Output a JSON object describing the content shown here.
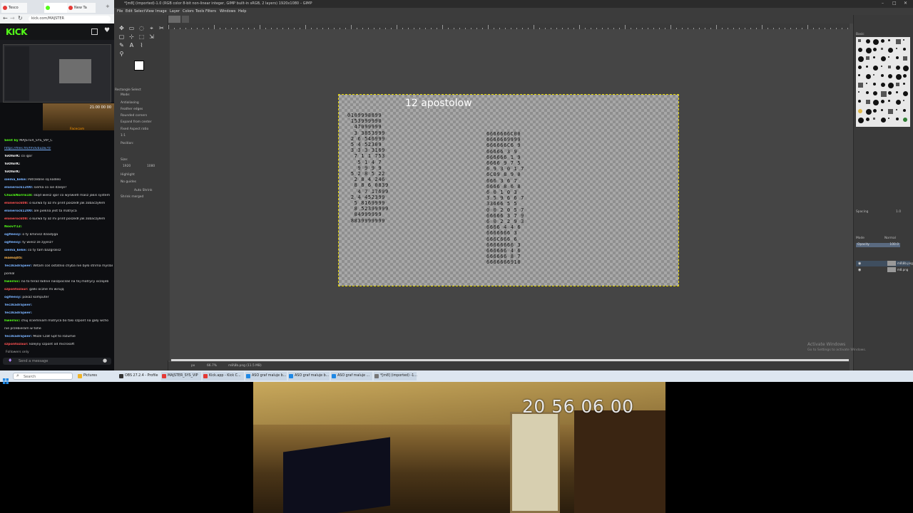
{
  "browser": {
    "tabs": [
      {
        "label": "Tesco",
        "color": "#e53935"
      },
      {
        "label": "",
        "color": "#53fc18"
      },
      {
        "label": "New Ta",
        "color": "#e53935"
      }
    ],
    "url": "kick.com/MAJSTER",
    "site_logo": "KICK",
    "chat_timestamp": "21:00 00 00",
    "overlay_label": "Facecam",
    "chat": [
      {
        "user": "Sent by",
        "user_color": "#53fc18",
        "text": "MAJSTER_SYS_VIP_C"
      },
      {
        "user": "",
        "user_color": "#53fc18",
        "text": "https://files.fm/f/hdvbuzw7tr"
      },
      {
        "user": "ToOhirK:",
        "user_color": "#ffffff",
        "text": "co igor"
      },
      {
        "user": "ToOhirK:",
        "user_color": "#ffffff",
        "text": ""
      },
      {
        "user": "ToOhirK:",
        "user_color": "#ffffff",
        "text": ""
      },
      {
        "user": "siema_keke:",
        "user_color": "#7ab3ff",
        "text": "Potrzebne są kodeki"
      },
      {
        "user": "elonerock1200:",
        "user_color": "#7ab3ff",
        "text": "siema co sie dzieje?"
      },
      {
        "user": "ChuckNorris18:",
        "user_color": "#53fc18",
        "text": "skąd wiesz igor co wyświetl masz jakiś system"
      },
      {
        "user": "elonerock08:",
        "user_color": "#ff5252",
        "text": "o kurwa ty az mi print poszedł jak zobaczyłem"
      },
      {
        "user": "elonerock1200:",
        "user_color": "#7ab3ff",
        "text": "ale piekna jest ta matryca"
      },
      {
        "user": "elonerock08:",
        "user_color": "#ff5252",
        "text": "o kurwa ty az mi print poszedł jak zobaczyłem"
      },
      {
        "user": "NoovY12:",
        "user_color": "#53fc18",
        "text": ""
      },
      {
        "user": "ogfleexy:",
        "user_color": "#7ab3ff",
        "text": "o ty kminisz dziadyga"
      },
      {
        "user": "ogfleexy:",
        "user_color": "#7ab3ff",
        "text": "ty wiesz ze zyjesz?"
      },
      {
        "user": "siema_keke:",
        "user_color": "#7ab3ff",
        "text": "co ty tam bazgrolisz"
      },
      {
        "user": "mamoj05:",
        "user_color": "#ffb74d",
        "text": ""
      },
      {
        "user": "Teczkadrajwer:",
        "user_color": "#7ab3ff",
        "text": "Witam coś ostatnio chyba nie było strima myślam"
      },
      {
        "user": "",
        "user_color": "#7ab3ff",
        "text": "poreal"
      },
      {
        "user": "hwernic:",
        "user_color": "#53fc18",
        "text": "no to teraz ładnie naszpocilaś na tej matrycy oczojeb"
      },
      {
        "user": "szpontozaur:",
        "user_color": "#ff5252",
        "text": "galki oczne mi wirują"
      },
      {
        "user": "ogfleexy:",
        "user_color": "#7ab3ff",
        "text": "pokaz komputer"
      },
      {
        "user": "Teczkadrajwer:",
        "user_color": "#7ab3ff",
        "text": ""
      },
      {
        "user": "Teczkadrajwer:",
        "user_color": "#7ab3ff",
        "text": ""
      },
      {
        "user": "hwernic:",
        "user_color": "#53fc18",
        "text": "chuj ściemniam matryca bo taki szpont na gały wcho"
      },
      {
        "user": "",
        "user_color": "#53fc18",
        "text": "nie przebieram w tohe"
      },
      {
        "user": "Teczkadrajwer:",
        "user_color": "#7ab3ff",
        "text": "Może Czat Gpt to rozumie"
      },
      {
        "user": "szpontozaur:",
        "user_color": "#ff5252",
        "text": "kolejny szpont od microsoft"
      }
    ],
    "followers_only": "Followers only",
    "send_placeholder": "Send a message"
  },
  "gimp": {
    "title": "*[m8] (imported)-1.0 (RGB color 8-bit non-linear integer, GIMP built-in sRGB, 2 layers) 1920x1080 – GIMP",
    "menu": [
      "File",
      "Edit",
      "Select",
      "View",
      "Image",
      "Layer",
      "Colors",
      "Tools",
      "Filters",
      "Windows",
      "Help"
    ],
    "tool_options": {
      "title": "Rectangle Select",
      "mode_label": "Mode:",
      "options": [
        "Antialiasing",
        "Feather edges",
        "Rounded corners",
        "Expand from center",
        "Fixed Aspect ratio"
      ],
      "ratio_value": "1:1",
      "position_label": "Position:",
      "position_unit": "px",
      "size_label": "Size:",
      "size_unit": "px",
      "size_w": "1920",
      "size_h": "1080",
      "highlight": "Highlight",
      "guides": "No guides",
      "auto_shrink": "Auto Shrink",
      "shrink_merged": "Shrink merged"
    },
    "image_title": "12 apostolow",
    "number_block_left": "0109998899\n 153999990\n  47099999\n  3 3853999\n 2 6 546999\n 5 4 52309\n 3 3 3 3169\n  7 1 1 753\n   5 1 4 7\n   9 9 9 9\n 5 2 8 5 22\n  2 8 4 246\n  8 8 6 0839\n   4 7 17699\n 2 4 452399\n  5 8169999\n  8 52399999\n  84999999\n 8839999999",
    "number_block_right": "6666666C00\n6666669999\n666666C6 9\n66666 3 9\n666666 1 9\n6666 9 7 5\n6 9 3 0 1 7\n6C09 8 9 0\n666 3 6 7\n6666 8 6 8\n6 0 1 0 3\n3 5 9 6 6 7\n33666 5 5\n0 0 2 0 5 7\n66666 3 7 9\n6 0 2 2 9 3\n6666 4 4 6\n6666666 3\n666C666 6\n66666666 3\n666666 4 6\n666666 8 7\n6666666910",
    "status": {
      "unit": "px",
      "zoom": "66.7%",
      "file": "m8\\8b.png (11.5 MB)"
    },
    "right_panel": {
      "brush_title": "Basic",
      "spacing_label": "Spacing",
      "spacing_value": "1.0",
      "mode_label": "Mode",
      "mode_value": "Normal",
      "opacity_label": "Opacity",
      "opacity_value": "100.0",
      "layers": [
        {
          "name": "m8\\8b.png"
        },
        {
          "name": "m8.png"
        }
      ]
    }
  },
  "activate_windows": {
    "title": "Activate Windows",
    "subtitle": "Go to Settings to activate Windows."
  },
  "taskbar": {
    "search_placeholder": "Search",
    "items": [
      {
        "label": "Pictures",
        "color": "#f0b429"
      },
      {
        "label": "OBS 27.2.4 - Profile",
        "color": "#333333"
      },
      {
        "label": "MAJSTER_SYS_VIP",
        "color": "#e53935"
      },
      {
        "label": "Kick.app - Kick C...",
        "color": "#e53935"
      },
      {
        "label": "ASO graf maluje b...",
        "color": "#1e88e5"
      },
      {
        "label": "ASO graf maluje b...",
        "color": "#1e88e5"
      },
      {
        "label": "ASO graf maluje ...",
        "color": "#1e88e5"
      },
      {
        "label": "*[m8] (imported) -1...",
        "color": "#777777"
      }
    ]
  },
  "webcam": {
    "timestamp": "20 56 06 00"
  }
}
